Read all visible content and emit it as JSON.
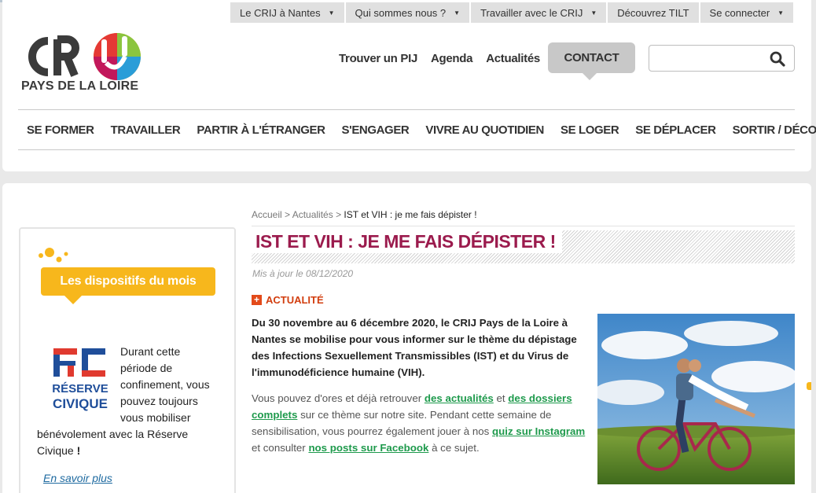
{
  "topnav": [
    {
      "label": "Le CRIJ à Nantes",
      "caret": true
    },
    {
      "label": "Qui sommes nous ?",
      "caret": true
    },
    {
      "label": "Travailler avec le CRIJ",
      "caret": true
    },
    {
      "label": "Découvrez TILT",
      "caret": false
    },
    {
      "label": "Se connecter",
      "caret": true
    }
  ],
  "logo": {
    "subtitle": "PAYS DE LA LOIRE"
  },
  "mainlinks": [
    "Trouver un PIJ",
    "Agenda",
    "Actualités"
  ],
  "contact_label": "CONTACT",
  "search": {
    "placeholder": "",
    "icon": "search-icon"
  },
  "categories": [
    "SE FORMER",
    "TRAVAILLER",
    "PARTIR À L'ÉTRANGER",
    "S'ENGAGER",
    "VIVRE AU QUOTIDIEN",
    "SE LOGER",
    "SE DÉPLACER",
    "SORTIR / DÉCOUVRIR"
  ],
  "sidebar": {
    "banner": "Les dispositifs du mois",
    "rc_logo": {
      "line1": "RC",
      "line2": "RÉSERVE",
      "line3": "CIVIQUE"
    },
    "text1": "Durant cette période de confinement, vous pouvez toujours vous mobiliser",
    "text2": "bénévolement avec la Réserve Civique",
    "text_end": " !",
    "more": "En savoir plus"
  },
  "breadcrumb": {
    "home": "Accueil",
    "sep": " > ",
    "section": "Actualités",
    "current": "IST et VIH : je me fais dépister !"
  },
  "article": {
    "title": "IST ET VIH : JE ME FAIS DÉPISTER !",
    "updated": "Mis à jour le 08/12/2020",
    "category": "ACTUALITÉ",
    "lead": "Du 30 novembre au 6 décembre 2020, le CRIJ Pays de la Loire à Nantes se mobilise pour vous informer sur le thème du dépistage des Infections Sexuellement Transmissibles (IST) et du Virus de l'immunodéficience humaine (VIH).",
    "p1": "Vous pouvez d'ores et déjà retrouver ",
    "link1": "des actualités",
    "p2": " et ",
    "link2": "des dossiers complets",
    "p3": " sur ce thème sur notre site. Pendant cette semaine de sensibilisation, vous pourrez également jouer à nos ",
    "link3": "quiz sur Instagram ",
    "p4": "et consulter ",
    "link4": "nos posts sur Facebook",
    "p5": " à ce sujet."
  },
  "colors": {
    "title": "#9b1b4d",
    "link": "#1e9a4c",
    "badge": "#e34a1a",
    "banner": "#f7b71c"
  }
}
